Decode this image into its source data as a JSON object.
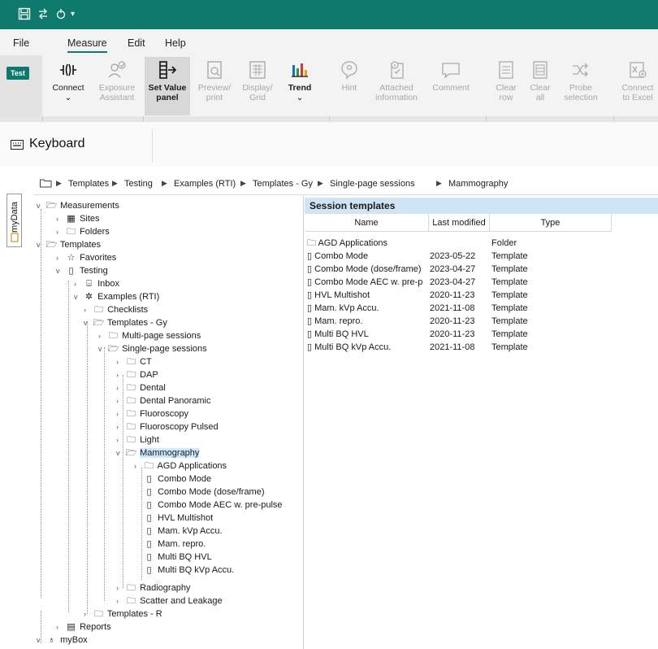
{
  "quick_access": {
    "icons": [
      "save-icon",
      "undo-redo-icon",
      "customize-icon",
      "dropdown-arrow"
    ]
  },
  "menu": {
    "items": [
      "File",
      "Measure",
      "Edit",
      "Help"
    ],
    "active": "Measure"
  },
  "ribbon": {
    "test_badge": "Test",
    "buttons": [
      {
        "label1": "Connect",
        "label2": "⌄",
        "icon": "connect-icon",
        "disabled": false
      },
      {
        "label1": "Exposure",
        "label2": "Assistant",
        "icon": "exposure-assistant-icon",
        "disabled": true
      },
      {
        "label1": "Set Value",
        "label2": "panel",
        "icon": "set-value-panel-icon",
        "disabled": false
      },
      {
        "label1": "Preview/",
        "label2": "print",
        "icon": "preview-print-icon",
        "disabled": true
      },
      {
        "label1": "Display/",
        "label2": "Grid",
        "icon": "display-grid-icon",
        "disabled": true
      },
      {
        "label1": "Trend",
        "label2": "⌄",
        "icon": "trend-icon",
        "disabled": false
      },
      {
        "label1": "Hint",
        "label2": "",
        "icon": "hint-icon",
        "disabled": true
      },
      {
        "label1": "Attached",
        "label2": "information",
        "icon": "attached-information-icon",
        "disabled": true
      },
      {
        "label1": "Comment",
        "label2": "",
        "icon": "comment-icon",
        "disabled": true
      },
      {
        "label1": "Clear",
        "label2": "row",
        "icon": "clear-row-icon",
        "disabled": true
      },
      {
        "label1": "Clear",
        "label2": "all",
        "icon": "clear-all-icon",
        "disabled": true
      },
      {
        "label1": "Probe",
        "label2": "selection",
        "icon": "probe-selection-icon",
        "disabled": true
      },
      {
        "label1": "Connect",
        "label2": "to Excel",
        "icon": "excel-icon",
        "disabled": true
      }
    ]
  },
  "keyboard_panel": {
    "title": "Keyboard"
  },
  "side_tab": {
    "label": "myData"
  },
  "breadcrumb": [
    "Templates",
    "Testing",
    "Examples (RTI)",
    "Templates - Gy",
    "Single-page sessions",
    "Mammography"
  ],
  "tree": [
    {
      "label": "Measurements",
      "icon": "folder-open-icon"
    },
    {
      "label": "Sites",
      "icon": "sites-icon"
    },
    {
      "label": "Folders",
      "icon": "folder-icon"
    },
    {
      "label": "Templates",
      "icon": "folder-open-icon"
    },
    {
      "label": "Favorites",
      "icon": "star-icon"
    },
    {
      "label": "Testing",
      "icon": "document-icon"
    },
    {
      "label": "Inbox",
      "icon": "inbox-icon"
    },
    {
      "label": "Examples (RTI)",
      "icon": "examples-icon"
    },
    {
      "label": "Checklists",
      "icon": "folder-icon"
    },
    {
      "label": "Templates - Gy",
      "icon": "folder-open-icon"
    },
    {
      "label": "Multi-page sessions",
      "icon": "folder-icon"
    },
    {
      "label": "Single-page sessions",
      "icon": "folder-open-icon"
    },
    {
      "label": "CT",
      "icon": "folder-icon"
    },
    {
      "label": "DAP",
      "icon": "folder-icon"
    },
    {
      "label": "Dental",
      "icon": "folder-icon"
    },
    {
      "label": "Dental Panoramic",
      "icon": "folder-icon"
    },
    {
      "label": "Fluoroscopy",
      "icon": "folder-icon"
    },
    {
      "label": "Fluoroscopy Pulsed",
      "icon": "folder-icon"
    },
    {
      "label": "Light",
      "icon": "folder-icon"
    },
    {
      "label": "Mammography",
      "icon": "folder-open-icon"
    },
    {
      "label": "AGD Applications",
      "icon": "folder-icon"
    },
    {
      "label": "Combo Mode",
      "icon": "document-icon"
    },
    {
      "label": "Combo Mode (dose/frame)",
      "icon": "document-icon"
    },
    {
      "label": "Combo Mode AEC w. pre-pulse",
      "icon": "document-icon"
    },
    {
      "label": "HVL Multishot",
      "icon": "document-icon"
    },
    {
      "label": "Mam. kVp Accu.",
      "icon": "document-icon"
    },
    {
      "label": "Mam. repro.",
      "icon": "document-icon"
    },
    {
      "label": "Multi BQ HVL",
      "icon": "document-icon"
    },
    {
      "label": "Multi BQ kVp Accu.",
      "icon": "document-icon"
    },
    {
      "label": "Radiography",
      "icon": "folder-icon"
    },
    {
      "label": "Scatter and Leakage",
      "icon": "folder-icon"
    },
    {
      "label": "Templates - R",
      "icon": "folder-icon"
    },
    {
      "label": "Reports",
      "icon": "reports-icon"
    },
    {
      "label": "myBox",
      "icon": "mybox-icon"
    }
  ],
  "session_templates": {
    "title": "Session templates",
    "columns": [
      "Name",
      "Last modified",
      "Type"
    ],
    "rows": [
      {
        "name": "AGD Applications",
        "modified": "",
        "type": "Folder",
        "icon": "folder-icon"
      },
      {
        "name": "Combo Mode",
        "modified": "2023-05-22",
        "type": "Template",
        "icon": "document-icon"
      },
      {
        "name": "Combo Mode (dose/frame)",
        "modified": "2023-04-27",
        "type": "Template",
        "icon": "document-icon"
      },
      {
        "name": "Combo Mode AEC w. pre-p",
        "modified": "2023-04-27",
        "type": "Template",
        "icon": "document-icon"
      },
      {
        "name": "HVL Multishot",
        "modified": "2020-11-23",
        "type": "Template",
        "icon": "document-icon"
      },
      {
        "name": "Mam. kVp Accu.",
        "modified": "2021-11-08",
        "type": "Template",
        "icon": "document-icon"
      },
      {
        "name": "Mam. repro.",
        "modified": "2020-11-23",
        "type": "Template",
        "icon": "document-icon"
      },
      {
        "name": "Multi BQ HVL",
        "modified": "2020-11-23",
        "type": "Template",
        "icon": "document-icon"
      },
      {
        "name": "Multi BQ kVp Accu.",
        "modified": "2021-11-08",
        "type": "Template",
        "icon": "document-icon"
      }
    ]
  },
  "colors": {
    "titlebar": "#0e7a6e",
    "selection": "#cce8ff",
    "list_header": "#cfe4f5",
    "test_badge": "#0e7a6e"
  }
}
